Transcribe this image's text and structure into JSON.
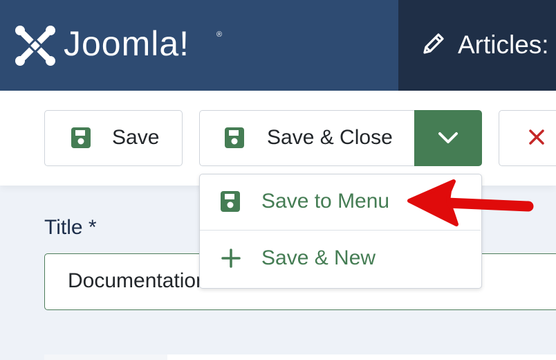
{
  "header": {
    "logo_text": "Joomla!",
    "logo_reg": "®",
    "page_title": "Articles:",
    "page_icon": "pencil-icon"
  },
  "toolbar": {
    "save_label": "Save",
    "save_close_label": "Save & Close",
    "save_icon": "floppy-disk-icon",
    "dropdown_toggle_icon": "chevron-down-icon",
    "cancel_icon": "close-icon"
  },
  "dropdown": {
    "items": [
      {
        "label": "Save to Menu",
        "icon": "floppy-disk-icon"
      },
      {
        "label": "Save & New",
        "icon": "plus-icon"
      }
    ]
  },
  "form": {
    "title_label": "Title *",
    "title_value": "Documentation"
  },
  "colors": {
    "header_bg": "#2e4b72",
    "header_dark": "#1f2f47",
    "accent_green": "#457d54",
    "cancel_red": "#c52727",
    "annotation_arrow": "#e00b0b"
  }
}
